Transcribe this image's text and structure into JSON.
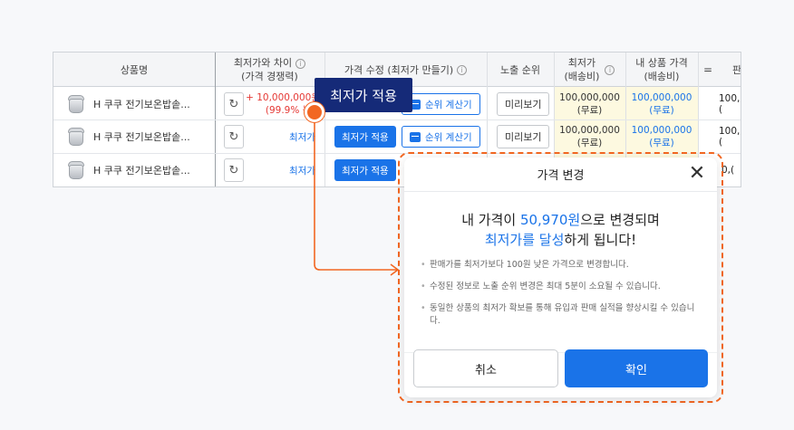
{
  "table": {
    "headers": {
      "product_name": "상품명",
      "lowest_diff": "최저가와 차이",
      "lowest_diff_sub": "(가격 경쟁력)",
      "price_edit": "가격 수정 (최저가 만들기)",
      "exposure_rank": "노출 순위",
      "lowest_price": "최저가",
      "lowest_price_sub": "(배송비)",
      "my_price": "내 상품 가격",
      "my_price_sub": "(배송비)",
      "eq": "=",
      "sale_partial": "판"
    },
    "rows": [
      {
        "product": "H 쿠쿠 전기보온밥솥...",
        "diff_amount": "+ 10,000,000원",
        "diff_pct": "(99.9% 높음",
        "diff_text": "",
        "apply_label": "최저가 적용",
        "calc_label": "순위 계산기",
        "preview_label": "미리보기",
        "lowest_price": "100,000,000",
        "lowest_ship": "(무료)",
        "my_price": "100,000,000",
        "my_ship": "(무료)",
        "sale_partial": "100,("
      },
      {
        "product": "H 쿠쿠 전기보온밥솥...",
        "diff_text": "최저가",
        "apply_label": "최저가 적용",
        "calc_label": "순위 계산기",
        "preview_label": "미리보기",
        "lowest_price": "100,000,000",
        "lowest_ship": "(무료)",
        "my_price": "100,000,000",
        "my_ship": "(무료)",
        "sale_partial": "100,("
      },
      {
        "product": "H 쿠쿠 전기보온밥솥...",
        "diff_text": "최저가",
        "apply_label": "최저가 적용",
        "sale_partial": "0,("
      }
    ]
  },
  "callout": {
    "label": "최저가 적용"
  },
  "modal": {
    "title": "가격 변경",
    "close_icon": "close-icon",
    "main_prefix": "내 가격이 ",
    "main_price": "50,970원",
    "main_suffix": "으로 변경되며",
    "main_hl2": "최저가를 달성",
    "main_end": "하게 됩니다!",
    "bullets": [
      "판매가를 최저가보다 100원 낮은 가격으로 변경합니다.",
      "수정된 정보로 노출 순위 변경은 최대 5분이 소요될 수 있습니다.",
      "동일한 상품의 최저가 확보를 통해 유입과 판매 실적을 향상시킬 수 있습니다."
    ],
    "cancel_label": "취소",
    "confirm_label": "확인"
  },
  "colors": {
    "primary": "#1a73e8",
    "accent": "#f26722",
    "callout_bg": "#152a78",
    "danger": "#e53935"
  }
}
